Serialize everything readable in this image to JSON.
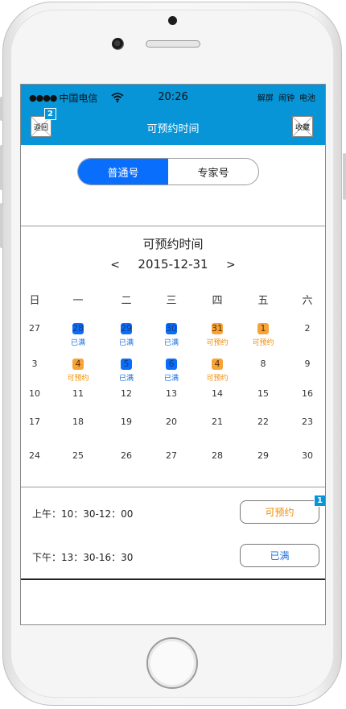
{
  "status_bar": {
    "signal": "●●●●",
    "carrier": "中国电信",
    "time": "20:26",
    "right": [
      "解屏",
      "闹钟",
      "电池"
    ]
  },
  "nav": {
    "back_label": "返回",
    "back_badge": "2",
    "title": "可预约时间",
    "fav_label": "收藏"
  },
  "segments": {
    "tabs": [
      "普通号",
      "专家号"
    ],
    "active": 0
  },
  "calendar": {
    "title": "可预约时间",
    "prev": "<",
    "date": "2015-12-31",
    "next": ">",
    "weekdays": [
      "日",
      "一",
      "二",
      "三",
      "四",
      "五",
      "六"
    ],
    "weeks": [
      [
        {
          "day": "27"
        },
        {
          "day": "28",
          "status": "已满",
          "color": "blue"
        },
        {
          "day": "29",
          "status": "已满",
          "color": "blue"
        },
        {
          "day": "30",
          "status": "已满",
          "color": "blue"
        },
        {
          "day": "31",
          "status": "可预约",
          "color": "orange"
        },
        {
          "day": "1",
          "status": "可预约",
          "color": "orange"
        },
        {
          "day": "2"
        }
      ],
      [
        {
          "day": "3"
        },
        {
          "day": "4",
          "status": "可预约",
          "color": "orange"
        },
        {
          "day": "5",
          "status": "已满",
          "color": "blue"
        },
        {
          "day": "6",
          "status": "已满",
          "color": "blue"
        },
        {
          "day": "4",
          "status": "可预约",
          "color": "orange"
        },
        {
          "day": "8"
        },
        {
          "day": "9"
        }
      ],
      [
        {
          "day": "10"
        },
        {
          "day": "11"
        },
        {
          "day": "12"
        },
        {
          "day": "13"
        },
        {
          "day": "14"
        },
        {
          "day": "15"
        },
        {
          "day": "16"
        }
      ],
      [
        {
          "day": "17"
        },
        {
          "day": "18"
        },
        {
          "day": "19"
        },
        {
          "day": "20"
        },
        {
          "day": "21"
        },
        {
          "day": "22"
        },
        {
          "day": "23"
        }
      ],
      [
        {
          "day": "24"
        },
        {
          "day": "25"
        },
        {
          "day": "26"
        },
        {
          "day": "27"
        },
        {
          "day": "28"
        },
        {
          "day": "29"
        },
        {
          "day": "30"
        }
      ]
    ]
  },
  "slots": [
    {
      "label": "上午：10：30-12：00",
      "button": "可预约",
      "color": "orange",
      "badge": "1"
    },
    {
      "label": "下午：13：30-16：30",
      "button": "已满",
      "color": "blue"
    }
  ],
  "colors": {
    "header": "#0795d8",
    "active_segment": "#0a6efc",
    "available": "#f08c00",
    "full": "#1b6fe0"
  }
}
